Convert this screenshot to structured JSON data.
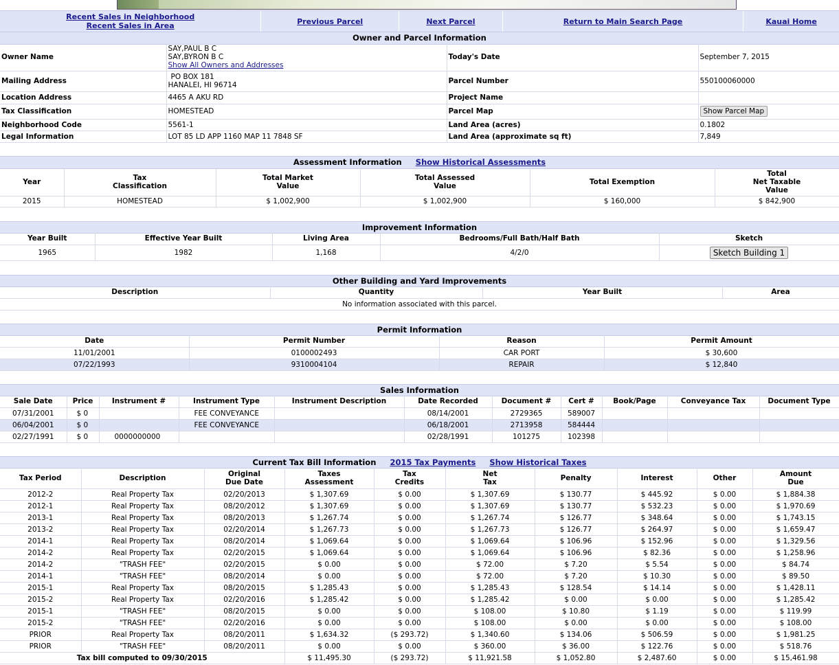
{
  "nav": {
    "recent_sales_neighborhood": "Recent Sales in Neighborhood",
    "recent_sales_area": "Recent Sales in Area",
    "previous_parcel": "Previous Parcel",
    "next_parcel": "Next Parcel",
    "return_main": "Return to Main Search Page",
    "kauai_home": "Kauai Home"
  },
  "owner": {
    "title": "Owner and Parcel Information",
    "owner_name_label": "Owner Name",
    "owner_names": [
      "SAY,PAUL B C",
      "SAY,BYRON B C"
    ],
    "show_all_owners": "Show All Owners and Addresses",
    "todays_date_label": "Today's Date",
    "todays_date": "September 7, 2015",
    "mailing_label": "Mailing Address",
    "mailing_line1": "PO BOX 181",
    "mailing_line2": "HANALEI, HI 96714",
    "parcel_number_label": "Parcel Number",
    "parcel_number": "550100060000",
    "location_label": "Location Address",
    "location": "4465 A AKU RD",
    "project_name_label": "Project Name",
    "project_name": "",
    "tax_class_label": "Tax Classification",
    "tax_class": "HOMESTEAD",
    "parcel_map_label": "Parcel Map",
    "show_parcel_map": "Show Parcel Map",
    "neighborhood_label": "Neighborhood Code",
    "neighborhood": "5561-1",
    "land_area_acres_label": "Land Area (acres)",
    "land_area_acres": "0.1802",
    "legal_label": "Legal Information",
    "legal": "LOT 85 LD APP 1160 MAP 11 7848 SF",
    "land_area_sqft_label": "Land Area (approximate sq ft)",
    "land_area_sqft": "7,849"
  },
  "assessment": {
    "title": "Assessment Information",
    "historical_link": "Show Historical Assessments",
    "headers": [
      "Year",
      "Tax\nClassification",
      "Total Market\nValue",
      "Total Assessed\nValue",
      "Total Exemption",
      "Total\nNet Taxable\nValue"
    ],
    "row": [
      "2015",
      "HOMESTEAD",
      "$ 1,002,900",
      "$ 1,002,900",
      "$ 160,000",
      "$ 842,900"
    ]
  },
  "improvement": {
    "title": "Improvement Information",
    "headers": [
      "Year Built",
      "Effective Year Built",
      "Living Area",
      "Bedrooms/Full Bath/Half Bath",
      "Sketch"
    ],
    "row": [
      "1965",
      "1982",
      "1,168",
      "4/2/0"
    ],
    "sketch_button": "Sketch Building 1"
  },
  "other": {
    "title": "Other Building and Yard Improvements",
    "headers": [
      "Description",
      "Quantity",
      "Year Built",
      "Area"
    ],
    "empty": "No information associated with this parcel."
  },
  "permit": {
    "title": "Permit Information",
    "headers": [
      "Date",
      "Permit Number",
      "Reason",
      "Permit Amount"
    ],
    "rows": [
      [
        "11/01/2001",
        "0100002493",
        "CAR PORT",
        "$ 30,600"
      ],
      [
        "07/22/1993",
        "9310004104",
        "REPAIR",
        "$ 12,840"
      ]
    ]
  },
  "sales": {
    "title": "Sales Information",
    "headers": [
      "Sale Date",
      "Price",
      "Instrument #",
      "Instrument Type",
      "Instrument Description",
      "Date Recorded",
      "Document #",
      "Cert #",
      "Book/Page",
      "Conveyance Tax",
      "Document Type"
    ],
    "rows": [
      [
        "07/31/2001",
        "$ 0",
        "",
        "FEE CONVEYANCE",
        "",
        "08/14/2001",
        "2729365",
        "589007",
        "",
        "",
        ""
      ],
      [
        "06/04/2001",
        "$ 0",
        "",
        "FEE CONVEYANCE",
        "",
        "06/18/2001",
        "2713958",
        "584444",
        "",
        "",
        ""
      ],
      [
        "02/27/1991",
        "$ 0",
        "0000000000",
        "",
        "",
        "02/28/1991",
        "101275",
        "102398",
        "",
        "",
        ""
      ]
    ]
  },
  "tax": {
    "title": "Current Tax Bill Information",
    "payments_link": "2015 Tax Payments",
    "historical_link": "Show Historical Taxes",
    "headers": [
      "Tax Period",
      "Description",
      "Original\nDue Date",
      "Taxes\nAssessment",
      "Tax\nCredits",
      "Net\nTax",
      "Penalty",
      "Interest",
      "Other",
      "Amount\nDue"
    ],
    "rows": [
      [
        "2012-2",
        "Real Property Tax",
        "02/20/2013",
        "$ 1,307.69",
        "$ 0.00",
        "$ 1,307.69",
        "$ 130.77",
        "$ 445.92",
        "$ 0.00",
        "$ 1,884.38"
      ],
      [
        "2012-1",
        "Real Property Tax",
        "08/20/2012",
        "$ 1,307.69",
        "$ 0.00",
        "$ 1,307.69",
        "$ 130.77",
        "$ 532.23",
        "$ 0.00",
        "$ 1,970.69"
      ],
      [
        "2013-1",
        "Real Property Tax",
        "08/20/2013",
        "$ 1,267.74",
        "$ 0.00",
        "$ 1,267.74",
        "$ 126.77",
        "$ 348.64",
        "$ 0.00",
        "$ 1,743.15"
      ],
      [
        "2013-2",
        "Real Property Tax",
        "02/20/2014",
        "$ 1,267.73",
        "$ 0.00",
        "$ 1,267.73",
        "$ 126.77",
        "$ 264.97",
        "$ 0.00",
        "$ 1,659.47"
      ],
      [
        "2014-1",
        "Real Property Tax",
        "08/20/2014",
        "$ 1,069.64",
        "$ 0.00",
        "$ 1,069.64",
        "$ 106.96",
        "$ 152.96",
        "$ 0.00",
        "$ 1,329.56"
      ],
      [
        "2014-2",
        "Real Property Tax",
        "02/20/2015",
        "$ 1,069.64",
        "$ 0.00",
        "$ 1,069.64",
        "$ 106.96",
        "$ 82.36",
        "$ 0.00",
        "$ 1,258.96"
      ],
      [
        "2014-2",
        "\"TRASH FEE\"",
        "02/20/2015",
        "$ 0.00",
        "$ 0.00",
        "$ 72.00",
        "$ 7.20",
        "$ 5.54",
        "$ 0.00",
        "$ 84.74"
      ],
      [
        "2014-1",
        "\"TRASH FEE\"",
        "08/20/2014",
        "$ 0.00",
        "$ 0.00",
        "$ 72.00",
        "$ 7.20",
        "$ 10.30",
        "$ 0.00",
        "$ 89.50"
      ],
      [
        "2015-1",
        "Real Property Tax",
        "08/20/2015",
        "$ 1,285.43",
        "$ 0.00",
        "$ 1,285.43",
        "$ 128.54",
        "$ 14.14",
        "$ 0.00",
        "$ 1,428.11"
      ],
      [
        "2015-2",
        "Real Property Tax",
        "02/20/2016",
        "$ 1,285.42",
        "$ 0.00",
        "$ 1,285.42",
        "$ 0.00",
        "$ 0.00",
        "$ 0.00",
        "$ 1,285.42"
      ],
      [
        "2015-1",
        "\"TRASH FEE\"",
        "08/20/2015",
        "$ 0.00",
        "$ 0.00",
        "$ 108.00",
        "$ 10.80",
        "$ 1.19",
        "$ 0.00",
        "$ 119.99"
      ],
      [
        "2015-2",
        "\"TRASH FEE\"",
        "02/20/2016",
        "$ 0.00",
        "$ 0.00",
        "$ 108.00",
        "$ 0.00",
        "$ 0.00",
        "$ 0.00",
        "$ 108.00"
      ],
      [
        "PRIOR",
        "Real Property Tax",
        "08/20/2011",
        "$ 1,634.32",
        "($ 293.72)",
        "$ 1,340.60",
        "$ 134.06",
        "$ 506.59",
        "$ 0.00",
        "$ 1,981.25"
      ],
      [
        "PRIOR",
        "\"TRASH FEE\"",
        "08/20/2011",
        "$ 0.00",
        "$ 0.00",
        "$ 360.00",
        "$ 36.00",
        "$ 122.76",
        "$ 0.00",
        "$ 518.76"
      ]
    ],
    "total_label": "Tax bill computed to 09/30/2015",
    "totals": [
      "$ 11,495.30",
      "($ 293.72)",
      "$ 11,921.58",
      "$ 1,052.80",
      "$ 2,487.60",
      "$ 0.00",
      "$ 15,461.98"
    ]
  }
}
